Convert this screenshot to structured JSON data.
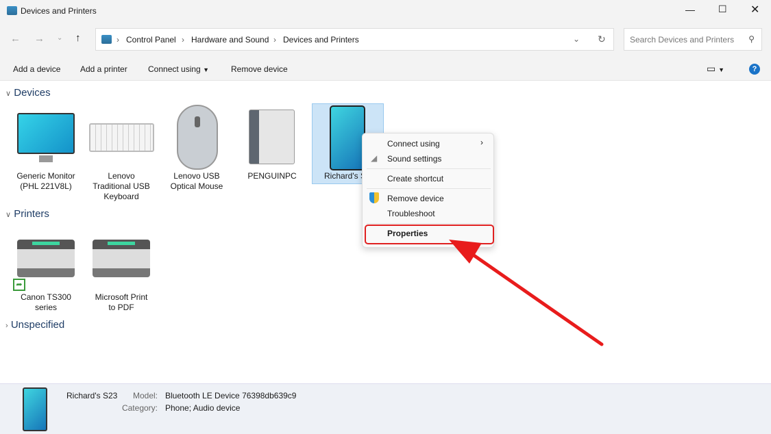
{
  "window": {
    "title": "Devices and Printers"
  },
  "nav": {
    "breadcrumb": [
      "Control Panel",
      "Hardware and Sound",
      "Devices and Printers"
    ],
    "search_placeholder": "Search Devices and Printers"
  },
  "toolbar": {
    "add_device": "Add a device",
    "add_printer": "Add a printer",
    "connect_using": "Connect using",
    "remove_device": "Remove device"
  },
  "sections": {
    "devices": "Devices",
    "printers": "Printers",
    "unspecified": "Unspecified"
  },
  "devices": [
    {
      "line1": "Generic Monitor",
      "line2": "(PHL 221V8L)",
      "line3": ""
    },
    {
      "line1": "Lenovo",
      "line2": "Traditional USB",
      "line3": "Keyboard"
    },
    {
      "line1": "Lenovo USB",
      "line2": "Optical Mouse",
      "line3": ""
    },
    {
      "line1": "PENGUINPC",
      "line2": "",
      "line3": ""
    },
    {
      "line1": "Richard's S",
      "line2": "",
      "line3": ""
    }
  ],
  "printers": [
    {
      "line1": "Canon TS300",
      "line2": "series"
    },
    {
      "line1": "Microsoft Print",
      "line2": "to PDF"
    }
  ],
  "context_menu": {
    "items": [
      "Connect using",
      "Sound settings",
      "Create shortcut",
      "Remove device",
      "Troubleshoot",
      "Properties"
    ]
  },
  "status": {
    "name": "Richard's S23",
    "model_label": "Model:",
    "model": "Bluetooth LE Device 76398db639c9",
    "category_label": "Category:",
    "category": "Phone; Audio device"
  },
  "colors": {
    "highlight": "#e02020",
    "selection": "#cce4f7"
  }
}
